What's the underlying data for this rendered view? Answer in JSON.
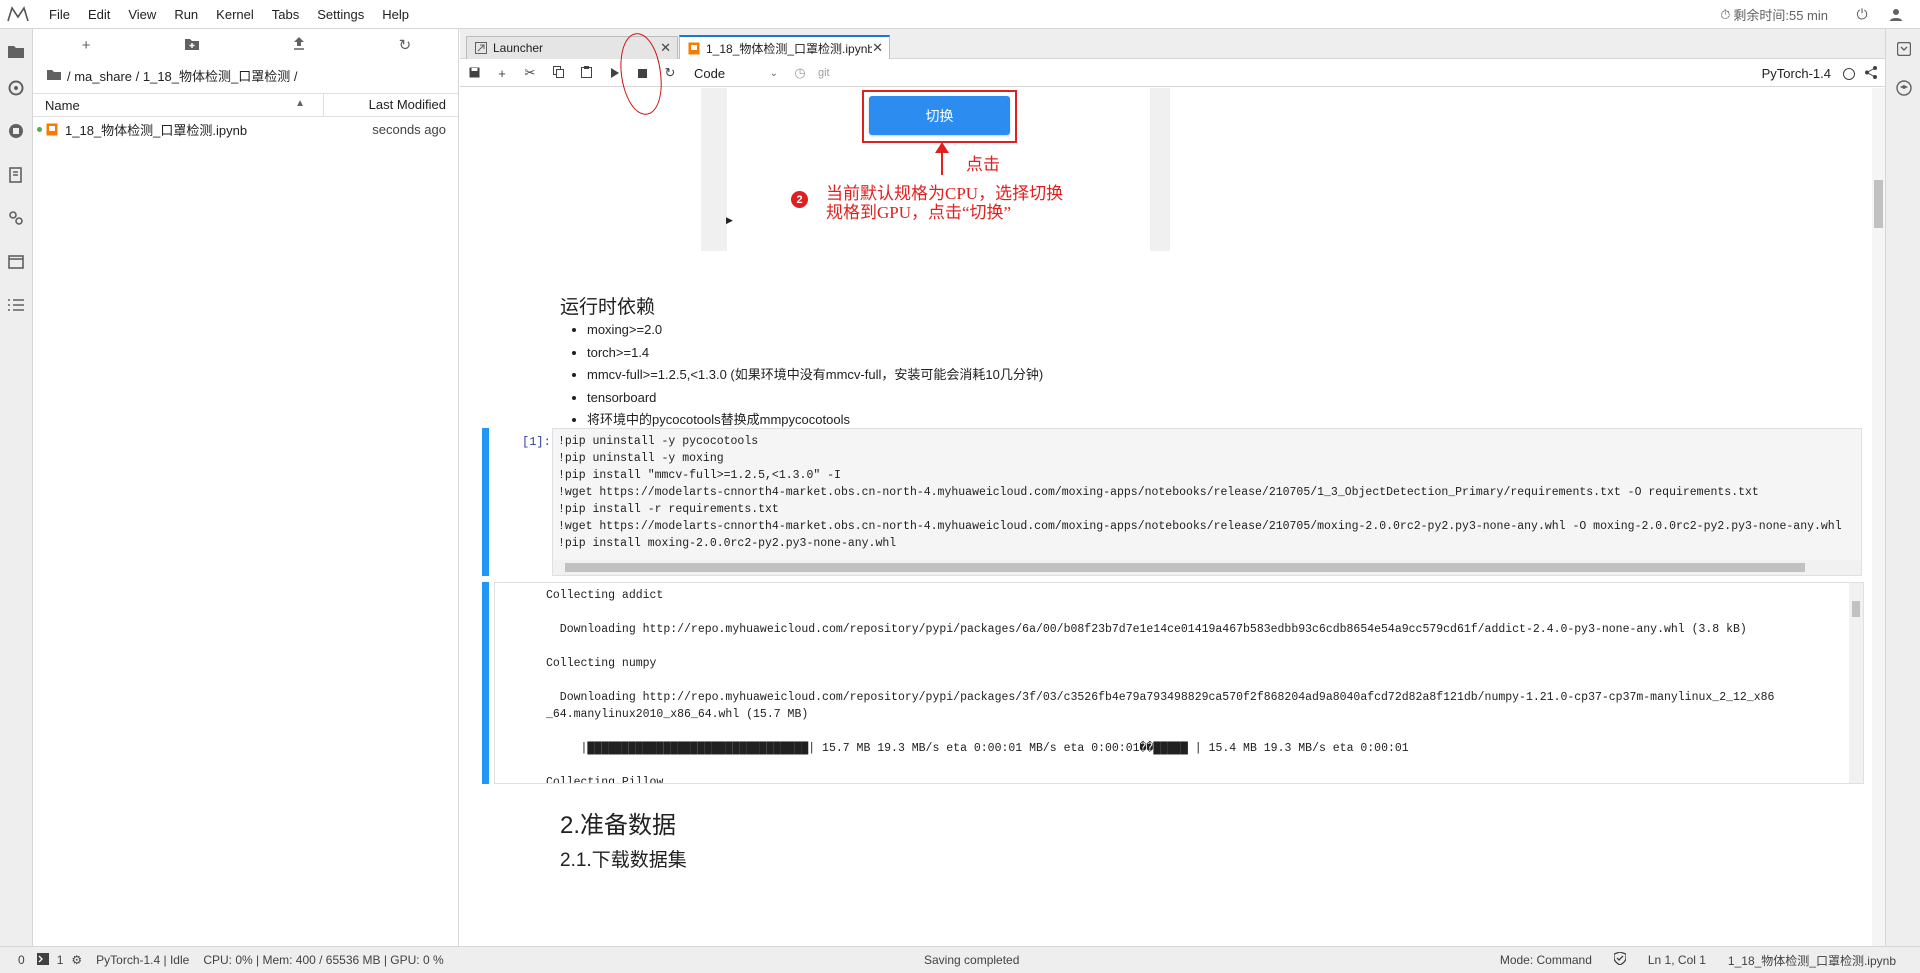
{
  "menubar": {
    "items": [
      "File",
      "Edit",
      "View",
      "Run",
      "Kernel",
      "Tabs",
      "Settings",
      "Help"
    ],
    "timer_label": "剩余时间:55 min"
  },
  "filebrowser": {
    "breadcrumb": "/ ma_share / 1_18_物体检测_口罩检测 /",
    "col_name": "Name",
    "col_modified": "Last Modified",
    "files": [
      {
        "name": "1_18_物体检测_口罩检测.ipynb",
        "modified": "seconds ago"
      }
    ]
  },
  "tabs": [
    {
      "label": "Launcher"
    },
    {
      "label": "1_18_物体检测_口罩检测.ipynb"
    }
  ],
  "toolbar": {
    "cell_type": "Code",
    "git_label": "git",
    "kernel_name": "PyTorch-1.4"
  },
  "embedded": {
    "switch_button": "切换",
    "click_label": "点击",
    "step_number": "2",
    "annotation": "当前默认规格为CPU，选择切换规格到GPU，点击“切换”"
  },
  "markdown": {
    "runtime_heading": "运行时依赖",
    "deps": [
      "moxing>=2.0",
      "torch>=1.4",
      "mmcv-full>=1.2.5,<1.3.0 (如果环境中没有mmcv-full，安装可能会消耗10几分钟)",
      "tensorboard",
      "将环境中的pycocotools替换成mmpycocotools"
    ],
    "section_heading": "2.准备数据",
    "subsection_heading": "2.1.下载数据集"
  },
  "code_cell": {
    "prompt": "[1]:",
    "lines": [
      "!pip uninstall -y pycocotools",
      "!pip uninstall -y moxing",
      "!pip install \"mmcv-full>=1.2.5,<1.3.0\" -I",
      "!wget https://modelarts-cnnorth4-market.obs.cn-north-4.myhuaweicloud.com/moxing-apps/notebooks/release/210705/1_3_ObjectDetection_Primary/requirements.txt -O requirements.txt",
      "!pip install -r requirements.txt",
      "!wget https://modelarts-cnnorth4-market.obs.cn-north-4.myhuaweicloud.com/moxing-apps/notebooks/release/210705/moxing-2.0.0rc2-py2.py3-none-any.whl -O moxing-2.0.0rc2-py2.py3-none-any.whl",
      "!pip install moxing-2.0.0rc2-py2.py3-none-any.whl"
    ]
  },
  "output": {
    "text": "Collecting addict\n\n  Downloading http://repo.myhuaweicloud.com/repository/pypi/packages/6a/00/b08f23b7d7e1e14ce01419a467b583edbb93c6cdb8654e54a9cc579cd61f/addict-2.4.0-py3-none-any.whl (3.8 kB)\n\nCollecting numpy\n\n  Downloading http://repo.myhuaweicloud.com/repository/pypi/packages/3f/03/c3526fb4e79a793498829ca570f2f868204ad9a8040afcd72d82a8f121db/numpy-1.21.0-cp37-cp37m-manylinux_2_12_x86\n_64.manylinux2010_x86_64.whl (15.7 MB)\n\n     |████████████████████████████████| 15.7 MB 19.3 MB/s eta 0:00:01 MB/s eta 0:00:01��█████ | 15.4 MB 19.3 MB/s eta 0:00:01\n\nCollecting Pillow"
  },
  "statusbar": {
    "count0": "0",
    "count1": "1",
    "kernel_status": "PyTorch-1.4 | Idle",
    "resources": "CPU: 0% | Mem: 400 / 65536 MB | GPU: 0 %",
    "saving": "Saving completed",
    "mode": "Mode: Command",
    "cursor": "Ln 1, Col 1",
    "filename": "1_18_物体检测_口罩检测.ipynb"
  },
  "colors": {
    "accent": "#2196f3",
    "annotation_red": "#e02020",
    "switch_button": "#2d8cf0"
  }
}
